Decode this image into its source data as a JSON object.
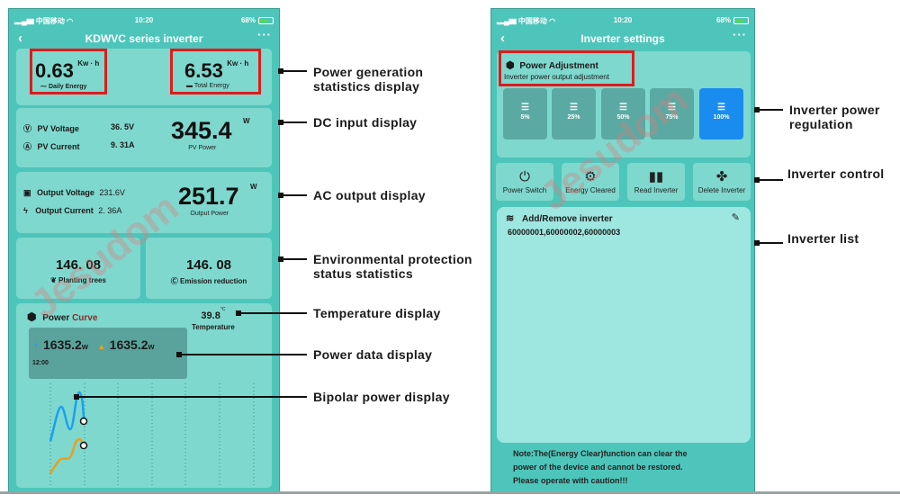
{
  "status_bar": {
    "carrier": "中国移动",
    "time": "10:20",
    "battery": "68%"
  },
  "screen1": {
    "title": "KDWVC series inverter",
    "back_icon": "‹",
    "more_icon": "···",
    "daily_energy": {
      "value": "0.63",
      "unit": "Kw · h",
      "label": "Daily Energy"
    },
    "total_energy": {
      "value": "6.53",
      "unit": "Kw · h",
      "label": "Total Energy"
    },
    "dc_input": {
      "pv_voltage_label": "PV Voltage",
      "pv_voltage_value": "36. 5V",
      "pv_current_label": "PV Current",
      "pv_current_value": "9. 31A",
      "pv_power_value": "345.4",
      "pv_power_unit": "W",
      "pv_power_label": "PV Power"
    },
    "ac_output": {
      "output_voltage_label": "Output Voltage",
      "output_voltage_value": "231.6V",
      "output_current_label": "Output Current",
      "output_current_value": "2. 36A",
      "output_power_value": "251.7",
      "output_power_unit": "W",
      "output_power_label": "Output Power"
    },
    "environment": {
      "trees_value": "146. 08",
      "trees_label": "Planting trees",
      "emission_value": "146. 08",
      "emission_label": "Emission reduction"
    },
    "power_curve": {
      "title_part1": "Power ",
      "title_part2": "Curve",
      "temperature_value": "39.8",
      "temperature_unit": "°C",
      "temperature_label": "Temperature",
      "power_a_value": "1635.2",
      "power_a_unit": "w",
      "power_b_value": "1635.2",
      "power_b_unit": "w",
      "time": "12:00",
      "colors": {
        "series_a": "#1aa0f0",
        "series_b": "#e8a020"
      }
    }
  },
  "screen2": {
    "title": "Inverter settings",
    "back_icon": "‹",
    "more_icon": "···",
    "power_adjustment": {
      "title": "Power  Adjustment",
      "subtitle": "Inverter power output adjustment",
      "options": [
        "5%",
        "25%",
        "50%",
        "75%",
        "100%"
      ],
      "selected": "100%"
    },
    "controls": [
      {
        "label": "Power Switch",
        "icon": "power-icon"
      },
      {
        "label": "Energy Cleared",
        "icon": "gear-icon"
      },
      {
        "label": "Read Inverter",
        "icon": "book-icon"
      },
      {
        "label": "Delete Inverter",
        "icon": "clover-icon"
      }
    ],
    "inverter_list": {
      "title": "Add/Remove inverter",
      "items": "60000001,60000002,60000003"
    },
    "note_lines": [
      "Note:The(Energy Clear)function can clear the",
      "power of the device and cannot be restored.",
      "Please operate with caution!!!"
    ]
  },
  "annotations": {
    "power_generation": [
      "Power generation",
      "statistics display"
    ],
    "dc_input": "DC input display",
    "ac_output": "AC output display",
    "environment": [
      "Environmental protection",
      "status statistics"
    ],
    "temperature": "Temperature display",
    "power_data": "Power data display",
    "bipolar": "Bipolar power display",
    "power_regulation": [
      "Inverter power",
      "regulation"
    ],
    "control": "Inverter control",
    "list": "Inverter list"
  },
  "watermark": "Jesudom"
}
